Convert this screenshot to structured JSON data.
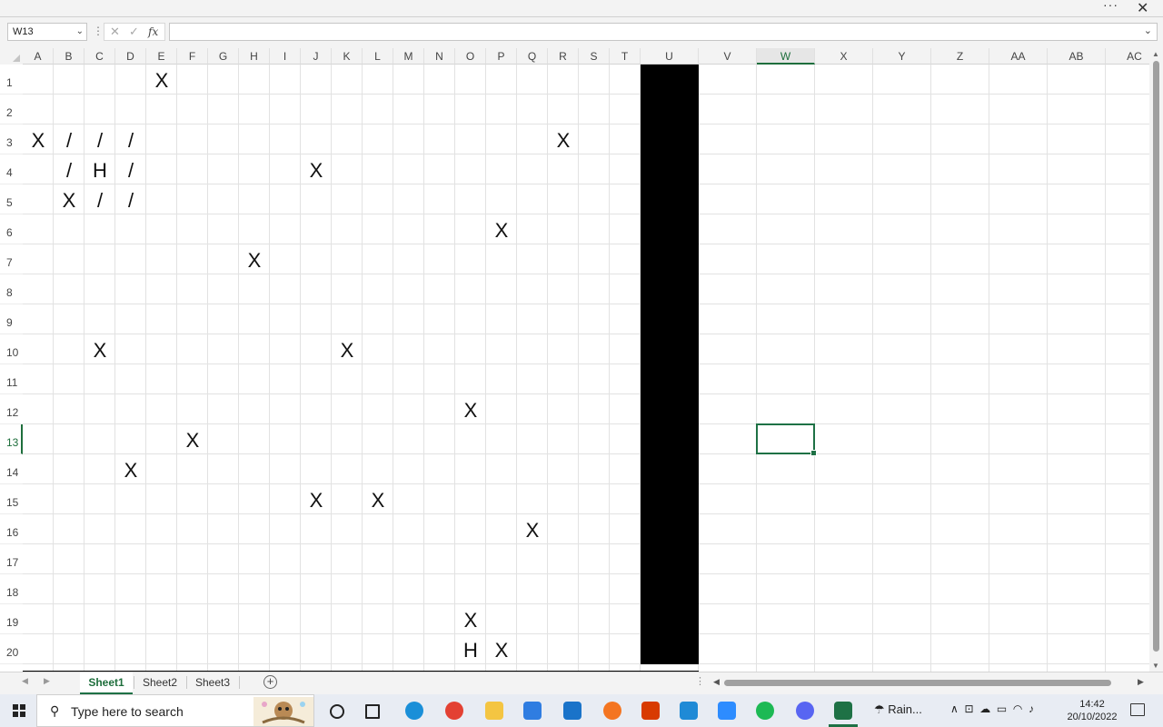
{
  "window": {
    "more_label": "···",
    "close_label": "✕"
  },
  "formula_bar": {
    "name_box": "W13",
    "fx_label": "fx",
    "cancel_icon": "✕",
    "enter_icon": "✓",
    "value": ""
  },
  "columns": [
    "A",
    "B",
    "C",
    "D",
    "E",
    "F",
    "G",
    "H",
    "I",
    "J",
    "K",
    "L",
    "M",
    "N",
    "O",
    "P",
    "Q",
    "R",
    "S",
    "T",
    "U",
    "V",
    "W",
    "X",
    "Y",
    "Z",
    "AA",
    "AB",
    "AC"
  ],
  "rows": [
    "1",
    "2",
    "3",
    "4",
    "5",
    "6",
    "7",
    "8",
    "9",
    "10",
    "11",
    "12",
    "13",
    "14",
    "15",
    "16",
    "17",
    "18",
    "19",
    "20",
    "21"
  ],
  "selected_cell": "W13",
  "fill": {
    "black_column": "U",
    "black_row": "21"
  },
  "cells": [
    {
      "ref": "E1",
      "value": "X"
    },
    {
      "ref": "A3",
      "value": "X"
    },
    {
      "ref": "B3",
      "value": "/"
    },
    {
      "ref": "C3",
      "value": "/"
    },
    {
      "ref": "D3",
      "value": "/"
    },
    {
      "ref": "R3",
      "value": "X"
    },
    {
      "ref": "B4",
      "value": "/"
    },
    {
      "ref": "C4",
      "value": "H"
    },
    {
      "ref": "D4",
      "value": "/"
    },
    {
      "ref": "J4",
      "value": "X"
    },
    {
      "ref": "B5",
      "value": "X"
    },
    {
      "ref": "C5",
      "value": "/"
    },
    {
      "ref": "D5",
      "value": "/"
    },
    {
      "ref": "P6",
      "value": "X"
    },
    {
      "ref": "H7",
      "value": "X"
    },
    {
      "ref": "C10",
      "value": "X"
    },
    {
      "ref": "K10",
      "value": "X"
    },
    {
      "ref": "O12",
      "value": "X"
    },
    {
      "ref": "F13",
      "value": "X"
    },
    {
      "ref": "D14",
      "value": "X"
    },
    {
      "ref": "J15",
      "value": "X"
    },
    {
      "ref": "L15",
      "value": "X"
    },
    {
      "ref": "Q16",
      "value": "X"
    },
    {
      "ref": "O19",
      "value": "X"
    },
    {
      "ref": "O20",
      "value": "H"
    },
    {
      "ref": "P20",
      "value": "X"
    }
  ],
  "sheets": [
    {
      "name": "Sheet1",
      "active": true
    },
    {
      "name": "Sheet2",
      "active": false
    },
    {
      "name": "Sheet3",
      "active": false
    }
  ],
  "taskbar": {
    "search_placeholder": "Type here to search",
    "apps": [
      {
        "icon": "cortana-icon",
        "color": "#222222"
      },
      {
        "icon": "task-view-icon",
        "color": "#222222"
      },
      {
        "icon": "edge-icon",
        "color": "#1a8fd8"
      },
      {
        "icon": "chrome-icon",
        "color": "#e34133"
      },
      {
        "icon": "file-explorer-icon",
        "color": "#f4c542"
      },
      {
        "icon": "store-icon",
        "color": "#2f7de1"
      },
      {
        "icon": "mail-icon",
        "color": "#1a73c9"
      },
      {
        "icon": "crunchyroll-icon",
        "color": "#f47521"
      },
      {
        "icon": "office-icon",
        "color": "#d83b01"
      },
      {
        "icon": "calculator-icon",
        "color": "#1f8ad6"
      },
      {
        "icon": "zoom-icon",
        "color": "#2d8cff"
      },
      {
        "icon": "spotify-icon",
        "color": "#1db954"
      },
      {
        "icon": "discord-icon",
        "color": "#5865f2"
      },
      {
        "icon": "excel-icon",
        "color": "#1e7145"
      }
    ],
    "weather": "Rain...",
    "time": "14:42",
    "date": "20/10/2022"
  }
}
